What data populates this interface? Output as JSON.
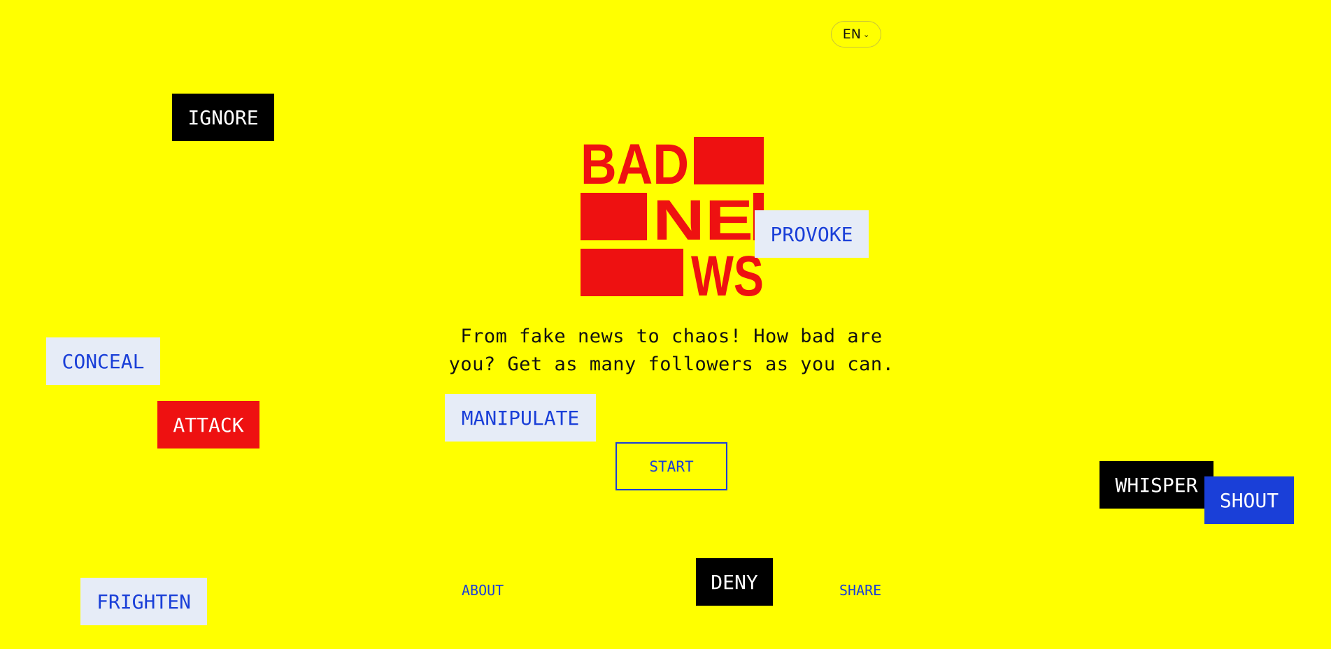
{
  "header": {
    "language": {
      "label": "EN",
      "chevron_icon": "chevron-down-icon"
    }
  },
  "logo": {
    "words": [
      "BAD",
      "NE",
      "WS"
    ],
    "colors": {
      "primary": "#ee1111"
    }
  },
  "hero": {
    "tagline": "From fake news to chaos! How bad are you? Get as many followers as you can.",
    "start_label": "START"
  },
  "footer": {
    "about_label": "ABOUT",
    "share_label": "SHARE"
  },
  "tags": {
    "ignore": "IGNORE",
    "provoke": "PROVOKE",
    "conceal": "CONCEAL",
    "attack": "ATTACK",
    "manipulate": "MANIPULATE",
    "whisper": "WHISPER",
    "shout": "SHOUT",
    "deny": "DENY",
    "frighten": "FRIGHTEN"
  },
  "colors": {
    "background": "#ffff00",
    "accent_blue": "#1a3fd8",
    "accent_red": "#ee1111",
    "tag_dark": "#000000",
    "tag_light": "#e6ecf7"
  }
}
